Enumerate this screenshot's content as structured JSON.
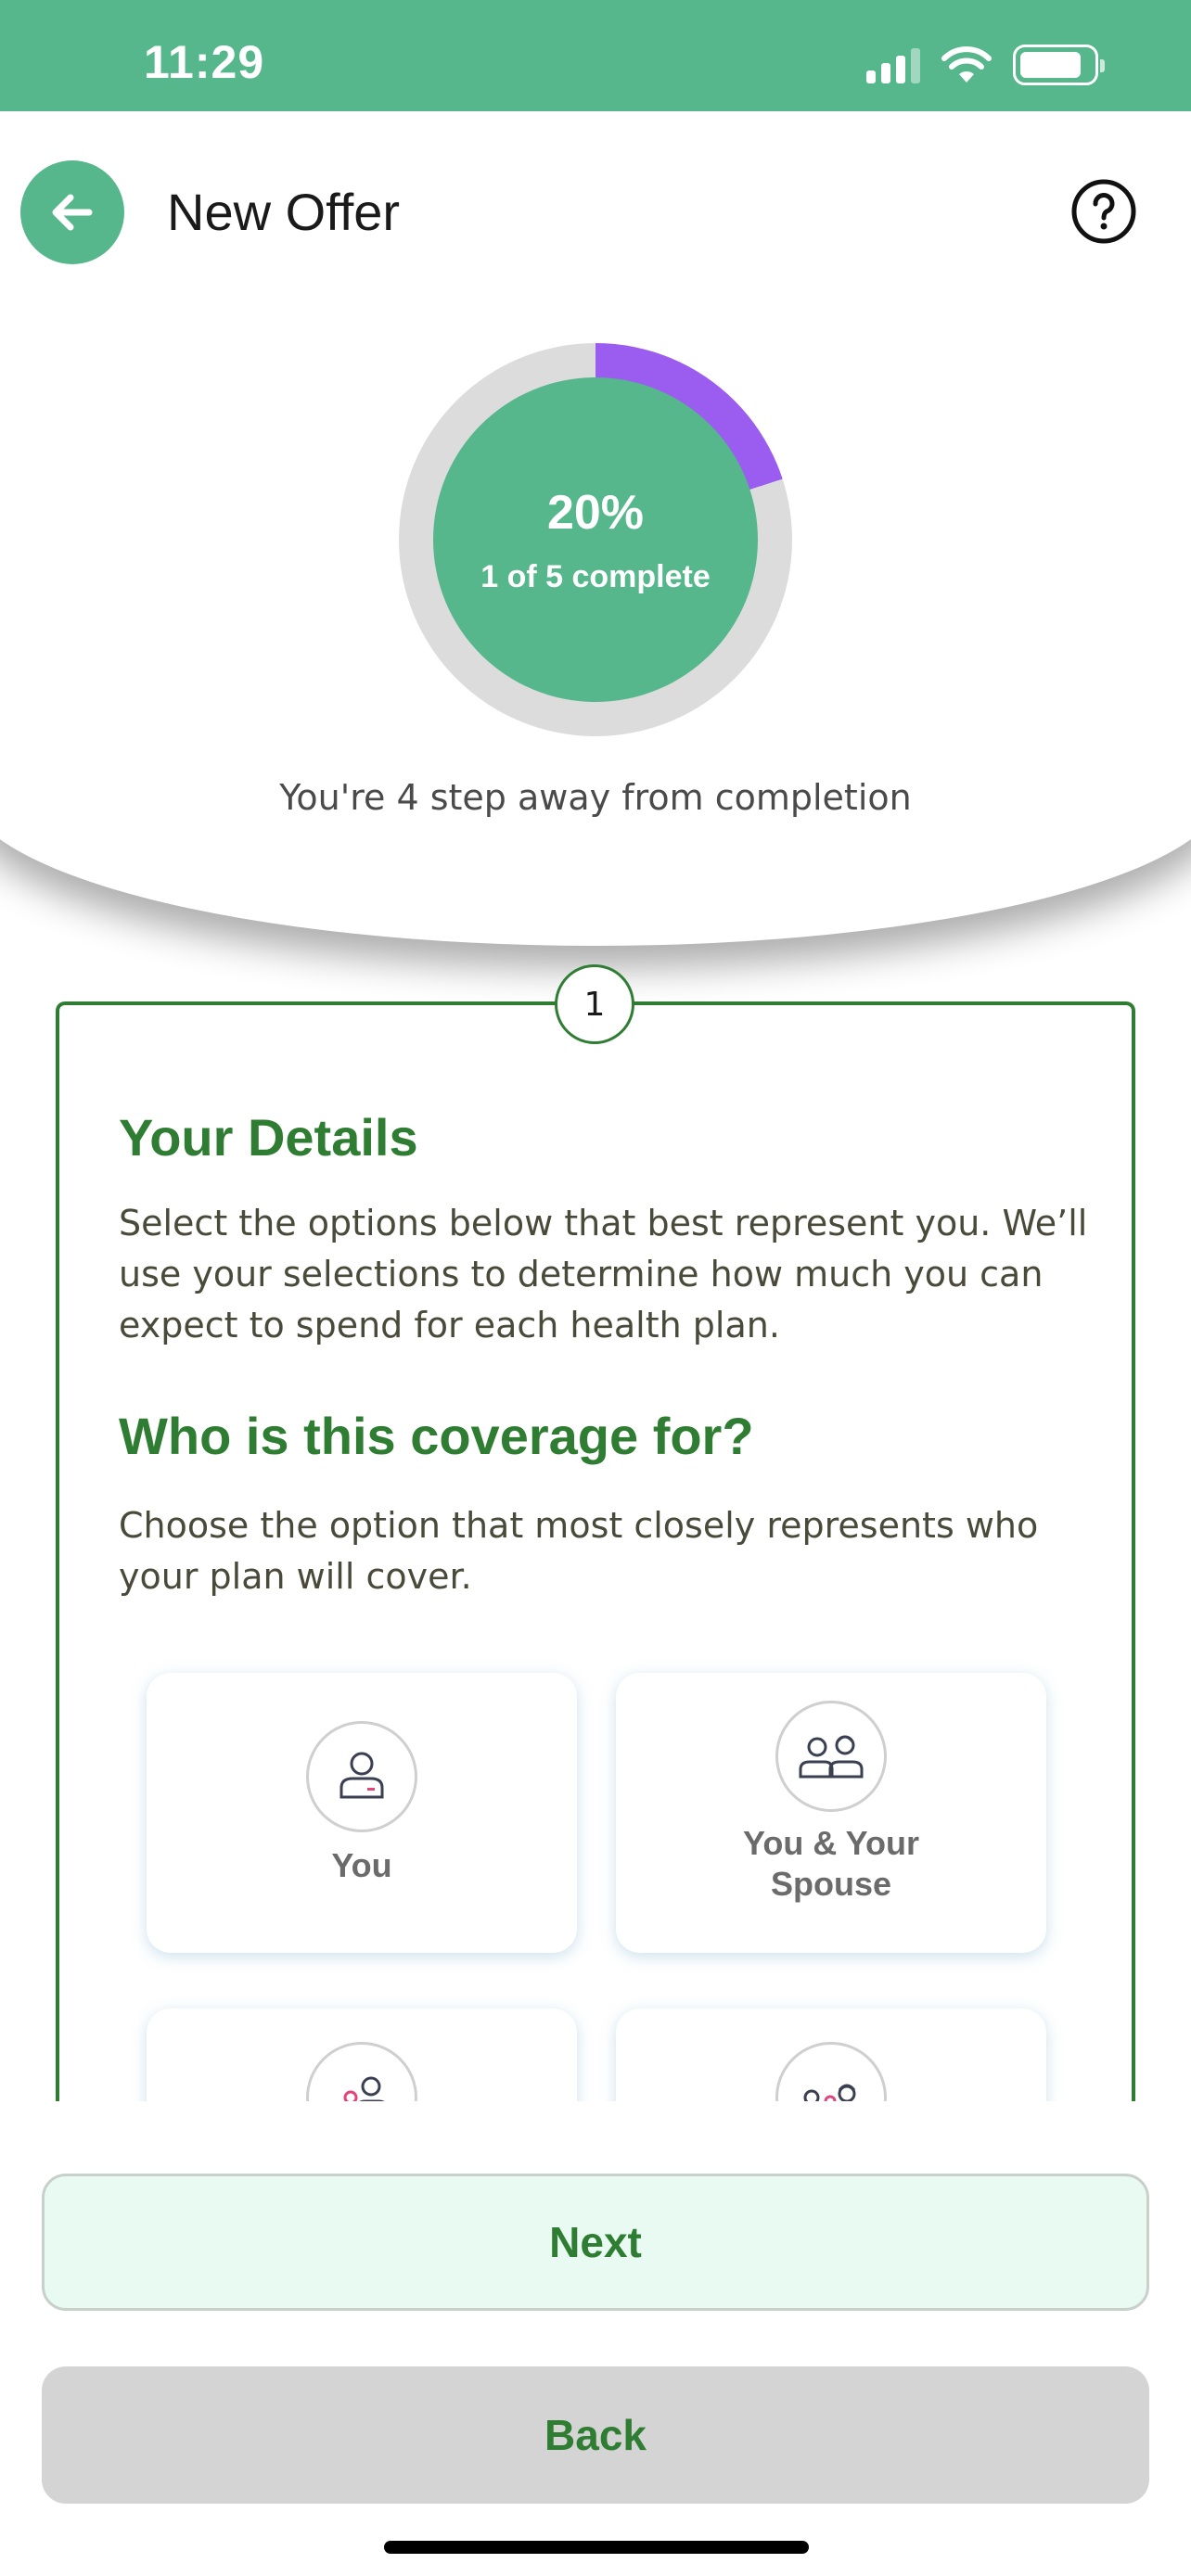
{
  "status_bar": {
    "time": "11:29",
    "icons": [
      "signal-icon",
      "wifi-icon",
      "battery-icon"
    ],
    "battery_level": 0.85
  },
  "header": {
    "title": "New Offer",
    "back_icon": "arrow-left-icon",
    "help_icon": "question-circle-icon"
  },
  "progress": {
    "percent_text": "20%",
    "fraction": 0.2,
    "label": "1 of 5 complete",
    "away_text": "You're 4 step away from completion"
  },
  "step": {
    "number": "1",
    "title": "Your Details",
    "description": "Select the options below that best represent you. We’ll use your selections to determine how much you can expect to spend for each health plan.",
    "question": "Who is this coverage for?",
    "question_hint": "Choose the option that most closely represents who your plan will cover.",
    "options": [
      {
        "label": "You",
        "icon": "person-icon"
      },
      {
        "label": "You & Your Spouse",
        "icon": "couple-icon"
      },
      {
        "label": "",
        "icon": "parent-child-icon"
      },
      {
        "label": "",
        "icon": "family-icon"
      }
    ]
  },
  "actions": {
    "next_label": "Next",
    "back_label": "Back"
  },
  "colors": {
    "brand_green": "#55b78b",
    "dark_green": "#2f7d32",
    "progress_accent": "#9b5cf0",
    "progress_track": "#dcdcdc"
  }
}
